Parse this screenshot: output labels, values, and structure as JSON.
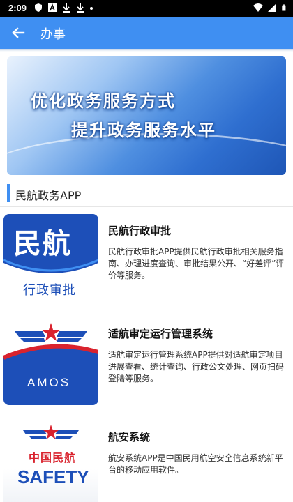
{
  "status_bar": {
    "time": "2:09",
    "icons": [
      "shield-icon",
      "a-icon",
      "download-icon",
      "download-icon",
      "wifi-icon",
      "signal-icon",
      "battery-icon"
    ]
  },
  "app_bar": {
    "back_icon": "back-arrow-icon",
    "title": "办事"
  },
  "banner": {
    "line1": "优化政务服务方式",
    "line2": "提升政务服务水平"
  },
  "section": {
    "title": "民航政务APP"
  },
  "apps": [
    {
      "name": "民航行政审批",
      "description": "民航行政审批APP提供民航行政审批相关服务指南、办理进度查询、审批结果公开、“好差评”评价等服务。",
      "logo": {
        "top_text": "民航",
        "bottom_text": "行政审批"
      }
    },
    {
      "name": "适航审定运行管理系统",
      "description": "适航审定运行管理系统APP提供对适航审定项目进展查看、统计查询、行政公文处理、网页扫码登陆等服务。",
      "logo": {
        "text": "AMOS"
      }
    },
    {
      "name": "航安系统",
      "description": "航安系统APP是中国民用航空安全信息系统新平台的移动应用软件。",
      "logo": {
        "top_text": "中国民航",
        "bottom_text": "SAFETY"
      }
    }
  ],
  "colors": {
    "primary": "#3f8ff2",
    "dark_blue": "#1d4fb8",
    "red": "#d9232e"
  }
}
